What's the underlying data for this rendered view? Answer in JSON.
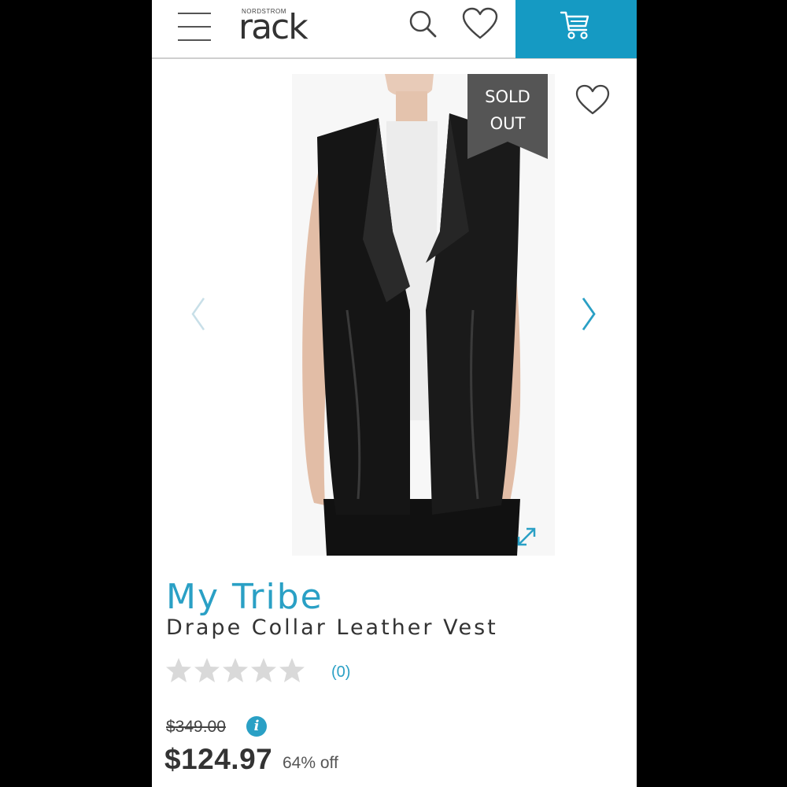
{
  "header": {
    "logo_small": "NORDSTROM",
    "logo_main": "rack"
  },
  "gallery": {
    "badge_line1": "SOLD",
    "badge_line2": "OUT"
  },
  "product": {
    "brand": "My Tribe",
    "name": "Drape Collar Leather Vest",
    "rating": 0,
    "review_count": "(0)",
    "original_price": "$349.00",
    "sale_price": "$124.97",
    "discount": "64% off"
  },
  "colors": {
    "accent": "#2aa0c5",
    "cart_bg": "#159ac3",
    "badge_bg": "#555555",
    "star_empty": "#d9d9d9"
  },
  "icons": [
    "menu-icon",
    "search-icon",
    "heart-icon",
    "cart-icon",
    "chevron-left-icon",
    "chevron-right-icon",
    "expand-icon",
    "info-icon",
    "star-icon"
  ]
}
